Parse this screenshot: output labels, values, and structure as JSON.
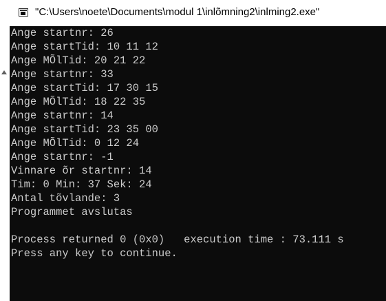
{
  "window": {
    "title": "\"C:\\Users\\noete\\Documents\\modul 1\\inlõmning2\\inlming2.exe\"",
    "icon": "console-app-icon"
  },
  "colors": {
    "console_background": "#0c0c0c",
    "console_text": "#cccccc",
    "titlebar_background": "#ffffff"
  },
  "console": {
    "lines": [
      "Ange startnr: 26",
      "Ange startTid: 10 11 12",
      "Ange MÕlTid: 20 21 22",
      "Ange startnr: 33",
      "Ange startTid: 17 30 15",
      "Ange MÕlTid: 18 22 35",
      "Ange startnr: 14",
      "Ange startTid: 23 35 00",
      "Ange MÕlTid: 0 12 24",
      "Ange startnr: -1",
      "Vinnare õr startnr: 14",
      "Tim: 0 Min: 37 Sek: 24",
      "Antal tõvlande: 3",
      "Programmet avslutas",
      "",
      "Process returned 0 (0x0)   execution time : 73.111 s",
      "Press any key to continue."
    ]
  }
}
